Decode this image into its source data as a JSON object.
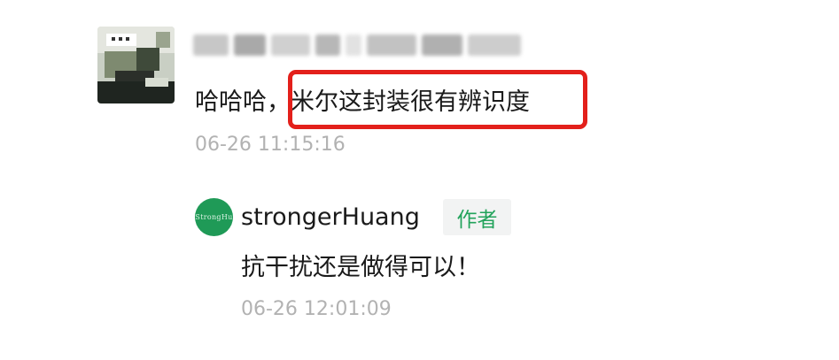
{
  "comment": {
    "prefix": "哈哈哈，",
    "highlight": "米尔这封装很有辨识度",
    "timestamp": "06-26 11:15:16"
  },
  "reply": {
    "avatar_initials": "StrongHu",
    "author": "strongerHuang",
    "author_badge": "作者",
    "text": "抗干扰还是做得可以！",
    "timestamp": "06-26 12:01:09"
  },
  "colors": {
    "highlight_border": "#e3201b",
    "badge_text": "#22a35b",
    "reply_avatar_bg": "#1f9a57",
    "timestamp": "#b2b2b2"
  }
}
